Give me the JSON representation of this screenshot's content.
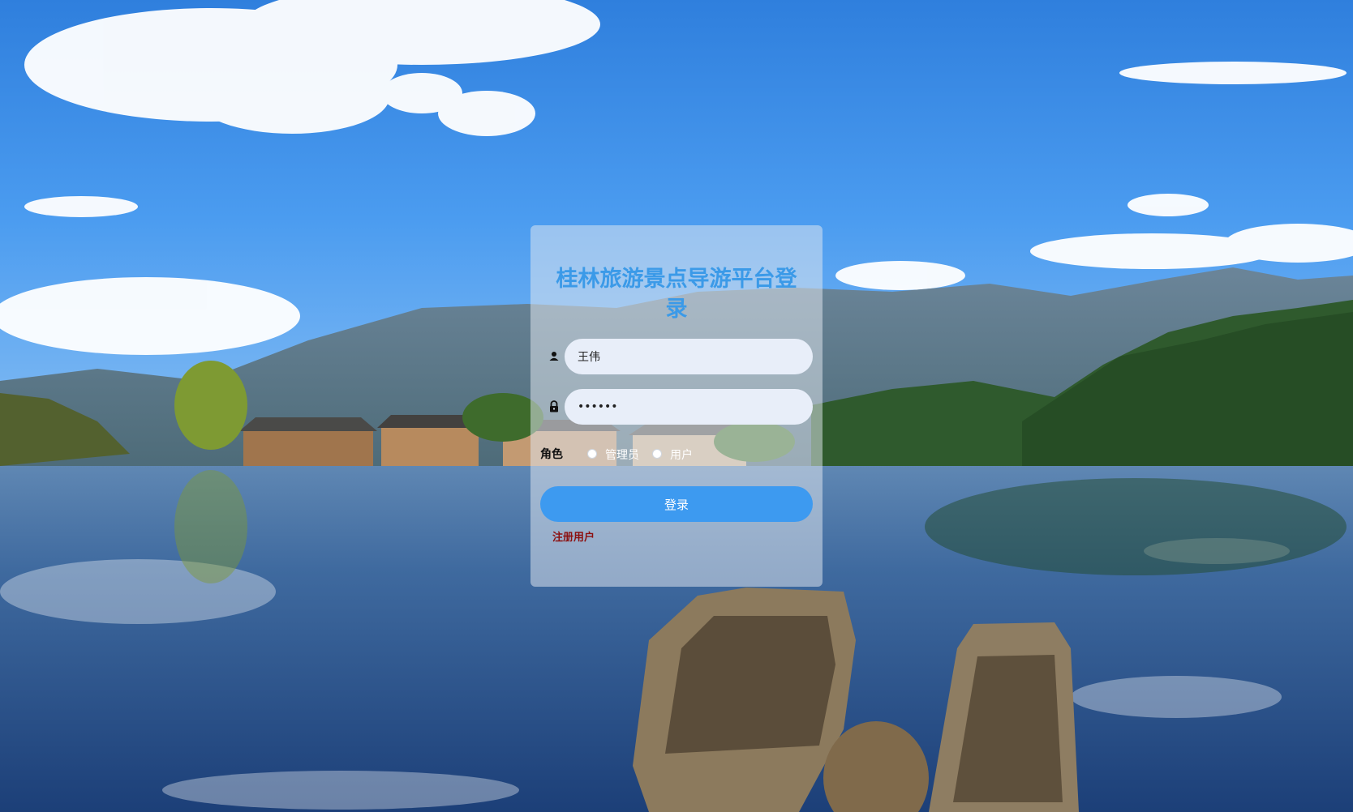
{
  "login": {
    "title": "桂林旅游景点导游平台登录",
    "username_value": "王伟",
    "password_value": "••••••",
    "role_label": "角色",
    "role_options": [
      "管理员",
      "用户"
    ],
    "login_button": "登录",
    "register_link": "注册用户"
  },
  "icons": {
    "username": "user-icon",
    "password": "lock-icon"
  },
  "colors": {
    "title": "#3b9ae8",
    "button": "#3d9af0",
    "register_link": "#8c1010"
  }
}
